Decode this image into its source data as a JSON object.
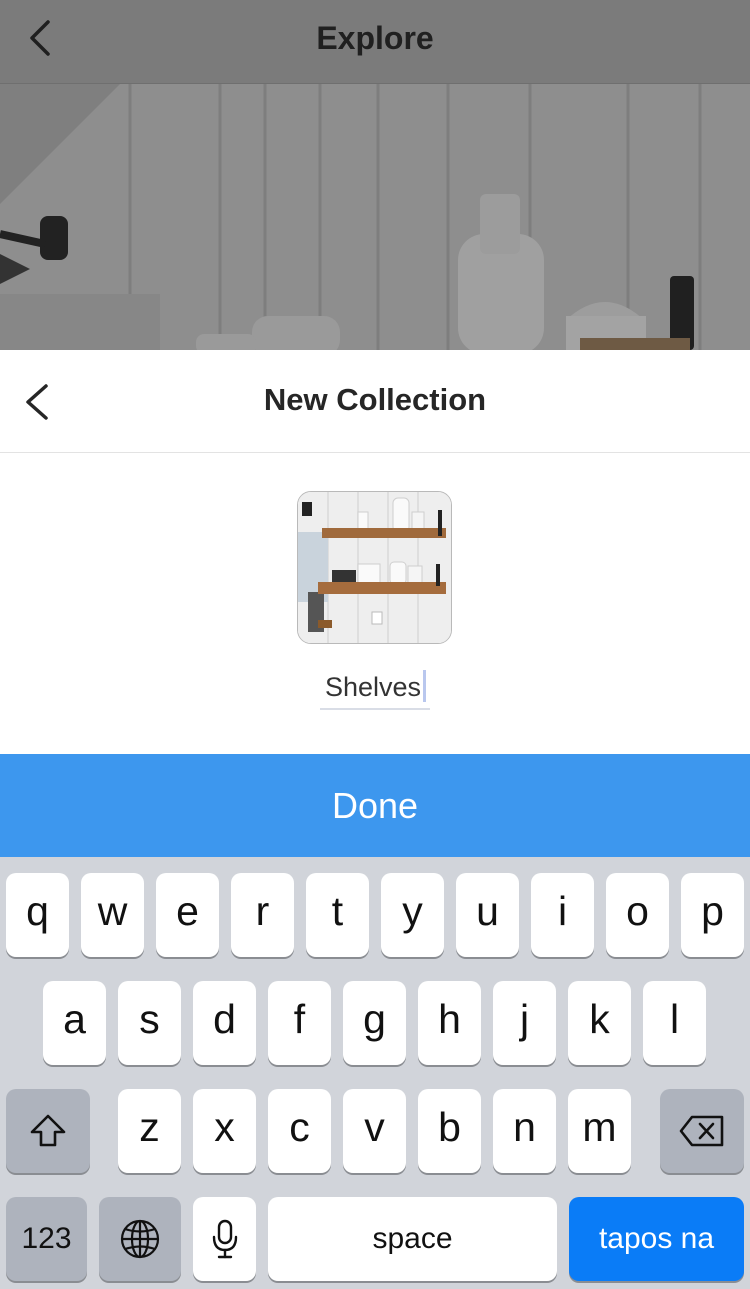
{
  "background_screen": {
    "title": "Explore",
    "back_icon": "chevron-left-icon"
  },
  "sheet": {
    "title": "New Collection",
    "back_icon": "chevron-left-icon",
    "collection_name": "Shelves",
    "done_label": "Done"
  },
  "keyboard": {
    "row1": [
      "q",
      "w",
      "e",
      "r",
      "t",
      "y",
      "u",
      "i",
      "o",
      "p"
    ],
    "row2": [
      "a",
      "s",
      "d",
      "f",
      "g",
      "h",
      "j",
      "k",
      "l"
    ],
    "row3": [
      "z",
      "x",
      "c",
      "v",
      "b",
      "n",
      "m"
    ],
    "shift_icon": "shift-icon",
    "delete_icon": "backspace-icon",
    "numbers_label": "123",
    "globe_icon": "globe-icon",
    "mic_icon": "microphone-icon",
    "space_label": "space",
    "return_label": "tapos na"
  },
  "colors": {
    "done_blue": "#3d97ee",
    "return_blue": "#0a7cf7",
    "keyboard_bg": "#d1d4da"
  }
}
